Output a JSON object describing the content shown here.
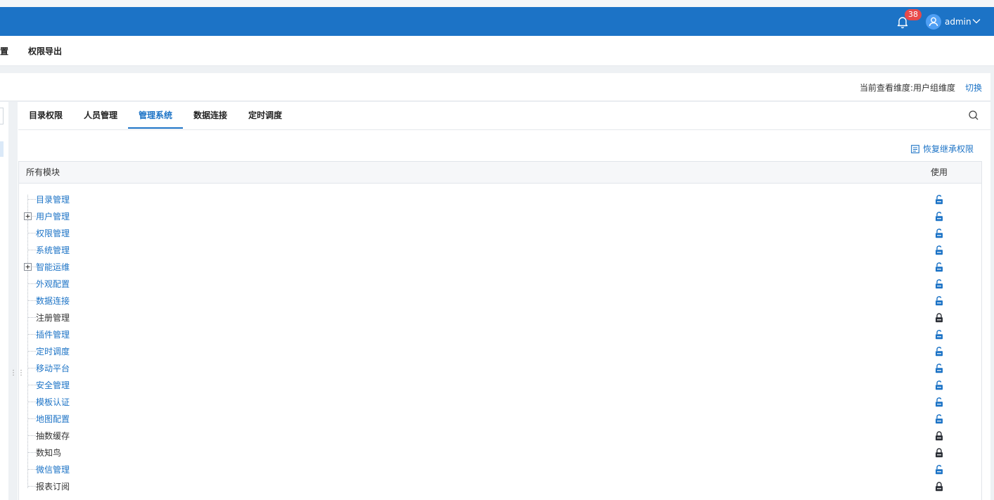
{
  "header": {
    "notification_count": "38",
    "user_name": "admin",
    "colors": {
      "bar": "#1c73c6",
      "badge": "#e84a4a"
    }
  },
  "menubar": {
    "items": [
      "置",
      "权限导出"
    ]
  },
  "dimension": {
    "label": "当前查看维度:用户组维度",
    "switch_label": "切换"
  },
  "tabs": [
    {
      "label": "目录权限",
      "active": false
    },
    {
      "label": "人员管理",
      "active": false
    },
    {
      "label": "管理系统",
      "active": true
    },
    {
      "label": "数据连接",
      "active": false
    },
    {
      "label": "定时调度",
      "active": false
    }
  ],
  "restore_label": "恢复继承权限",
  "table": {
    "col_module": "所有模块",
    "col_use": "使用",
    "rows": [
      {
        "label": "目录管理",
        "expandable": false,
        "unlocked": true
      },
      {
        "label": "用户管理",
        "expandable": true,
        "unlocked": true
      },
      {
        "label": "权限管理",
        "expandable": false,
        "unlocked": true
      },
      {
        "label": "系统管理",
        "expandable": false,
        "unlocked": true
      },
      {
        "label": "智能运维",
        "expandable": true,
        "unlocked": true
      },
      {
        "label": "外观配置",
        "expandable": false,
        "unlocked": true
      },
      {
        "label": "数据连接",
        "expandable": false,
        "unlocked": true
      },
      {
        "label": "注册管理",
        "expandable": false,
        "unlocked": false
      },
      {
        "label": "插件管理",
        "expandable": false,
        "unlocked": true
      },
      {
        "label": "定时调度",
        "expandable": false,
        "unlocked": true
      },
      {
        "label": "移动平台",
        "expandable": false,
        "unlocked": true
      },
      {
        "label": "安全管理",
        "expandable": false,
        "unlocked": true
      },
      {
        "label": "模板认证",
        "expandable": false,
        "unlocked": true
      },
      {
        "label": "地图配置",
        "expandable": false,
        "unlocked": true
      },
      {
        "label": "抽数缓存",
        "expandable": false,
        "unlocked": false
      },
      {
        "label": "数知鸟",
        "expandable": false,
        "unlocked": false
      },
      {
        "label": "微信管理",
        "expandable": false,
        "unlocked": true
      },
      {
        "label": "报表订阅",
        "expandable": false,
        "unlocked": false
      }
    ]
  }
}
